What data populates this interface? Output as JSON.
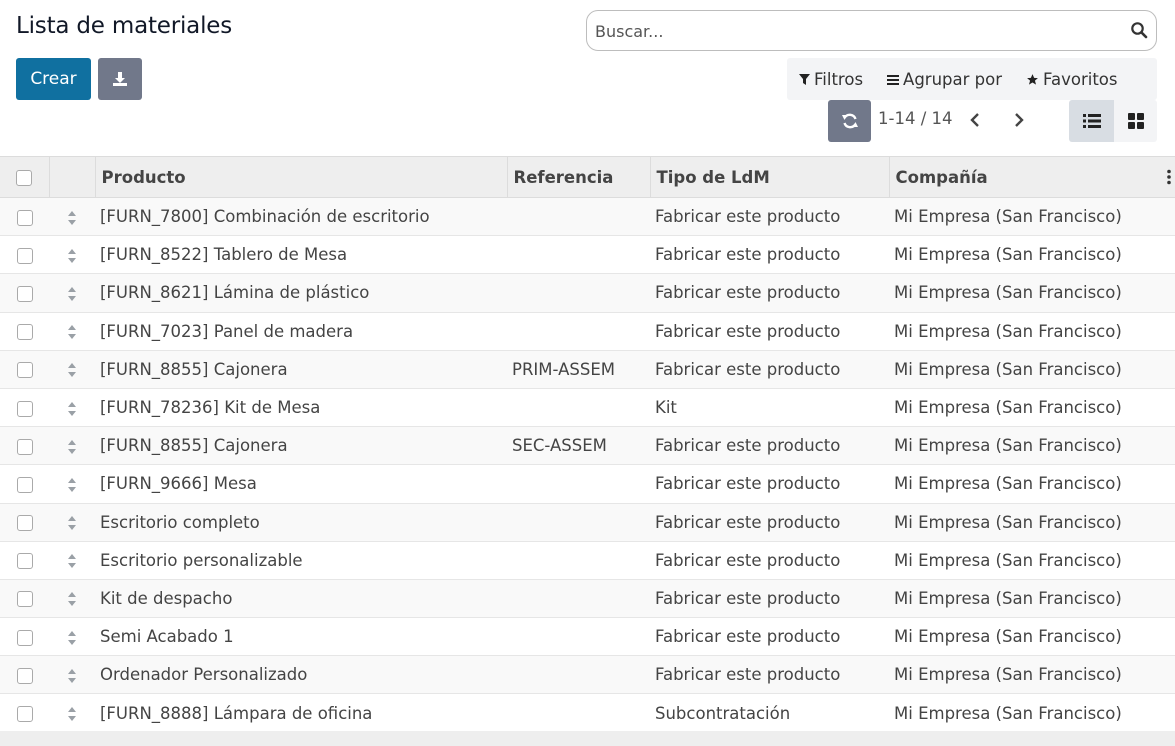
{
  "page": {
    "title": "Lista de materiales"
  },
  "toolbar": {
    "create_label": "Crear"
  },
  "search": {
    "placeholder": "Buscar..."
  },
  "filters": {
    "filter_label": "Filtros",
    "group_label": "Agrupar por",
    "favorites_label": "Favoritos"
  },
  "pager": {
    "value": "1-14 / 14"
  },
  "table": {
    "columns": [
      "Producto",
      "Referencia",
      "Tipo de LdM",
      "Compañía"
    ],
    "rows": [
      {
        "product": "[FURN_7800] Combinación de escritorio",
        "reference": "",
        "type": "Fabricar este producto",
        "company": "Mi Empresa (San Francisco)"
      },
      {
        "product": "[FURN_8522] Tablero de Mesa",
        "reference": "",
        "type": "Fabricar este producto",
        "company": "Mi Empresa (San Francisco)"
      },
      {
        "product": "[FURN_8621] Lámina de plástico",
        "reference": "",
        "type": "Fabricar este producto",
        "company": "Mi Empresa (San Francisco)"
      },
      {
        "product": "[FURN_7023] Panel de madera",
        "reference": "",
        "type": "Fabricar este producto",
        "company": "Mi Empresa (San Francisco)"
      },
      {
        "product": "[FURN_8855] Cajonera",
        "reference": "PRIM-ASSEM",
        "type": "Fabricar este producto",
        "company": "Mi Empresa (San Francisco)"
      },
      {
        "product": "[FURN_78236] Kit de Mesa",
        "reference": "",
        "type": "Kit",
        "company": "Mi Empresa (San Francisco)"
      },
      {
        "product": "[FURN_8855] Cajonera",
        "reference": "SEC-ASSEM",
        "type": "Fabricar este producto",
        "company": "Mi Empresa (San Francisco)"
      },
      {
        "product": "[FURN_9666] Mesa",
        "reference": "",
        "type": "Fabricar este producto",
        "company": "Mi Empresa (San Francisco)"
      },
      {
        "product": "Escritorio completo",
        "reference": "",
        "type": "Fabricar este producto",
        "company": "Mi Empresa (San Francisco)"
      },
      {
        "product": "Escritorio personalizable",
        "reference": "",
        "type": "Fabricar este producto",
        "company": "Mi Empresa (San Francisco)"
      },
      {
        "product": "Kit de despacho",
        "reference": "",
        "type": "Fabricar este producto",
        "company": "Mi Empresa (San Francisco)"
      },
      {
        "product": "Semi Acabado 1",
        "reference": "",
        "type": "Fabricar este producto",
        "company": "Mi Empresa (San Francisco)"
      },
      {
        "product": "Ordenador Personalizado",
        "reference": "",
        "type": "Fabricar este producto",
        "company": "Mi Empresa (San Francisco)"
      },
      {
        "product": "[FURN_8888] Lámpara de oficina",
        "reference": "",
        "type": "Subcontratación",
        "company": "Mi Empresa (San Francisco)"
      }
    ]
  },
  "icons": {
    "download": "download-icon",
    "search": "search-icon",
    "filter": "filter-icon",
    "group": "group-by-icon",
    "favorites": "star-icon",
    "refresh": "refresh-icon",
    "prev": "chevron-left-icon",
    "next": "chevron-right-icon",
    "list_view": "list-view-icon",
    "kanban_view": "kanban-view-icon",
    "drag_handle": "drag-handle-icon",
    "optional_columns": "kebab-icon"
  },
  "colors": {
    "primary": "#1070a0",
    "secondary": "#71788a",
    "header_bg": "#eeeeee"
  }
}
